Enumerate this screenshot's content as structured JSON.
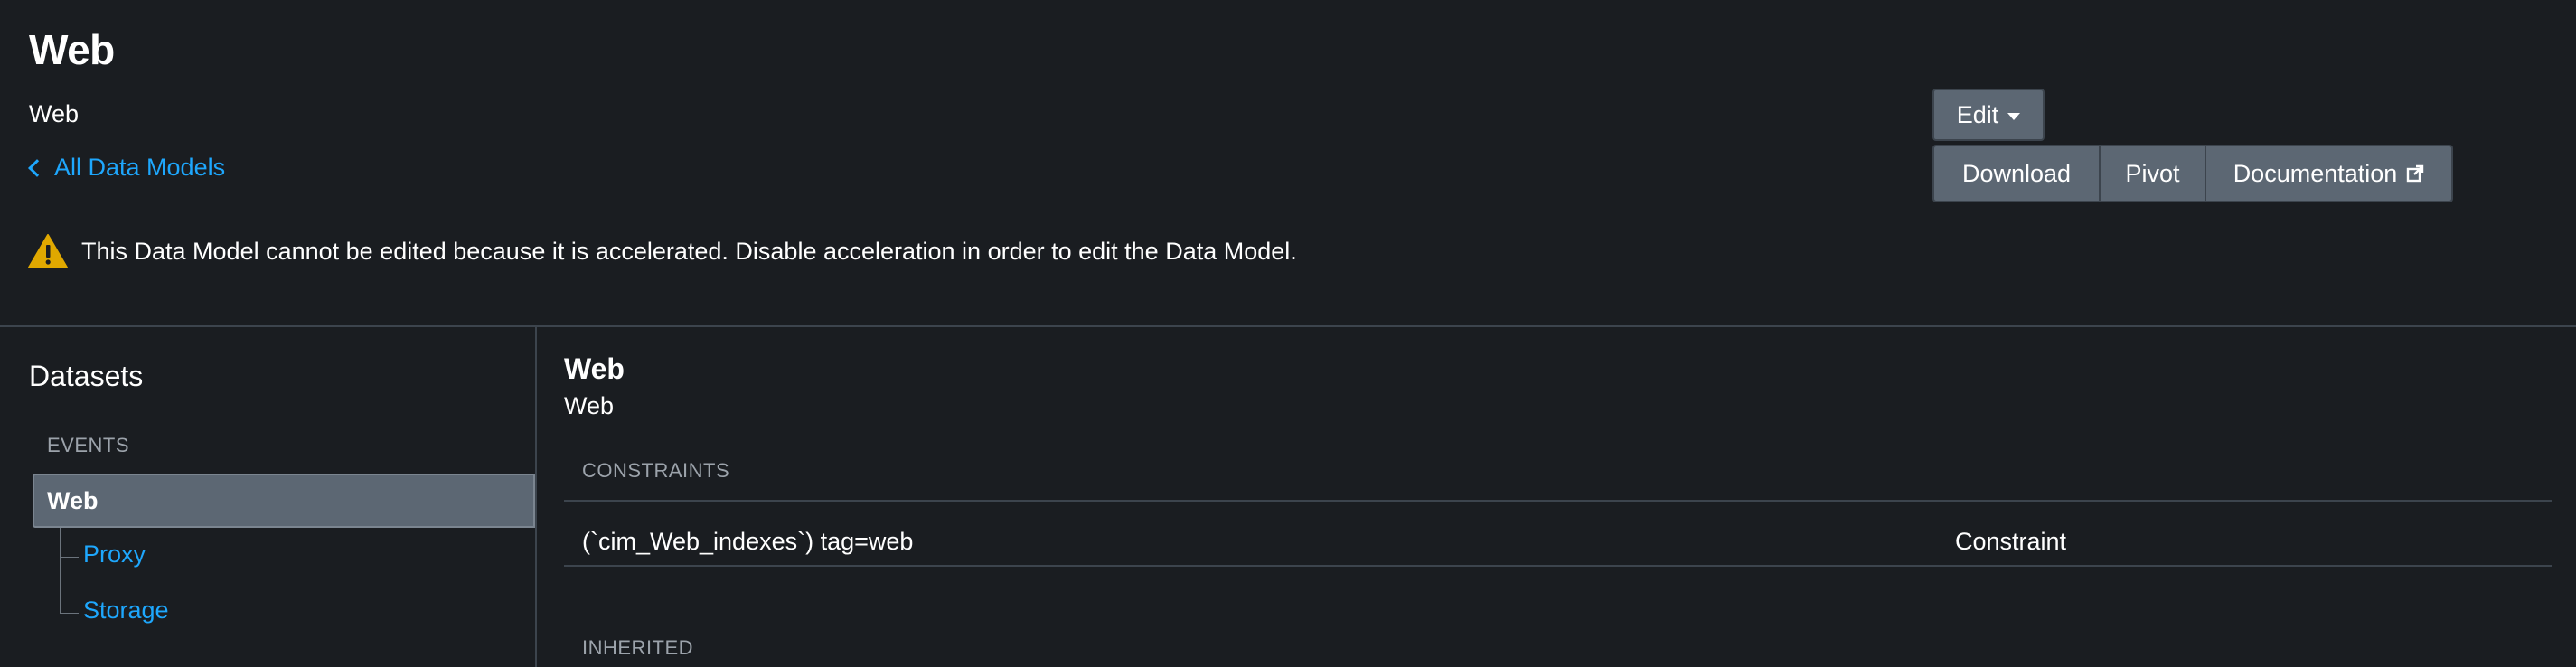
{
  "header": {
    "title": "Web",
    "subtitle": "Web",
    "back_link": "All Data Models"
  },
  "warning": {
    "icon": "warning-icon",
    "text": "This Data Model cannot be edited because it is accelerated. Disable acceleration in order to edit the Data Model."
  },
  "toolbar": {
    "edit_label": "Edit",
    "download_label": "Download",
    "pivot_label": "Pivot",
    "documentation_label": "Documentation"
  },
  "sidebar": {
    "title": "Datasets",
    "group_label": "EVENTS",
    "selected_item": "Web",
    "children": [
      "Proxy",
      "Storage"
    ]
  },
  "main": {
    "title": "Web",
    "subtitle": "Web",
    "constraints_label": "CONSTRAINTS",
    "constraints": [
      {
        "expression": "(`cim_Web_indexes`) tag=web",
        "type": "Constraint"
      }
    ],
    "inherited_label": "INHERITED"
  },
  "colors": {
    "background": "#1a1d21",
    "link": "#1ea7fd",
    "button": "#5c6773",
    "warning": "#e0a800"
  }
}
